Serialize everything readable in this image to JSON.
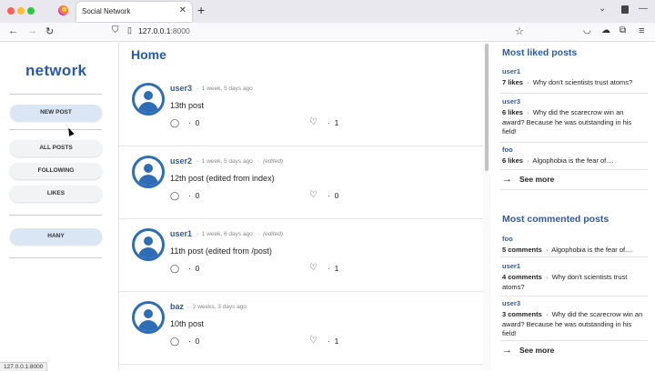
{
  "browser": {
    "tab_title": "Social Network",
    "url_host": "127.0.0.1",
    "url_port": ":8000",
    "status_url": "127.0.0.1:8000"
  },
  "sidebar": {
    "logo": "network",
    "new_post": "NEW POST",
    "all_posts": "ALL POSTS",
    "following": "FOLLOWING",
    "likes": "LIKES",
    "user": "HANY"
  },
  "main": {
    "title": "Home",
    "posts": [
      {
        "user": "user3",
        "time": "1 week, 5 days ago",
        "edited": "",
        "text": "13th post",
        "comments": "0",
        "likes": "1"
      },
      {
        "user": "user2",
        "time": "1 week, 5 days ago",
        "edited": "(edited)",
        "text": "12th post (edited from index)",
        "comments": "0",
        "likes": "0"
      },
      {
        "user": "user1",
        "time": "1 week, 6 days ago",
        "edited": "(edited)",
        "text": "11th post (edited from /post)",
        "comments": "0",
        "likes": "1"
      },
      {
        "user": "baz",
        "time": "2 weeks, 3 days ago",
        "edited": "",
        "text": "10th post",
        "comments": "0",
        "likes": "1"
      }
    ]
  },
  "right": {
    "liked_title": "Most liked posts",
    "liked": [
      {
        "user": "user1",
        "count": "7 likes",
        "text": "Why don't scientists trust atoms?"
      },
      {
        "user": "user3",
        "count": "6 likes",
        "text": "Why did the scarecrow win an award? Because he was outstanding in his field!"
      },
      {
        "user": "foo",
        "count": "6 likes",
        "text": "Algophobia is the fear of...."
      }
    ],
    "see_more": "See more",
    "commented_title": "Most commented posts",
    "commented": [
      {
        "user": "foo",
        "count": "5 comments",
        "text": "Algophobia is the fear of...."
      },
      {
        "user": "user1",
        "count": "4 comments",
        "text": "Why don't scientists trust atoms?"
      },
      {
        "user": "user3",
        "count": "3 comments",
        "text": "Why did the scarecrow win an award? Because he was outstanding in his field!"
      }
    ]
  }
}
